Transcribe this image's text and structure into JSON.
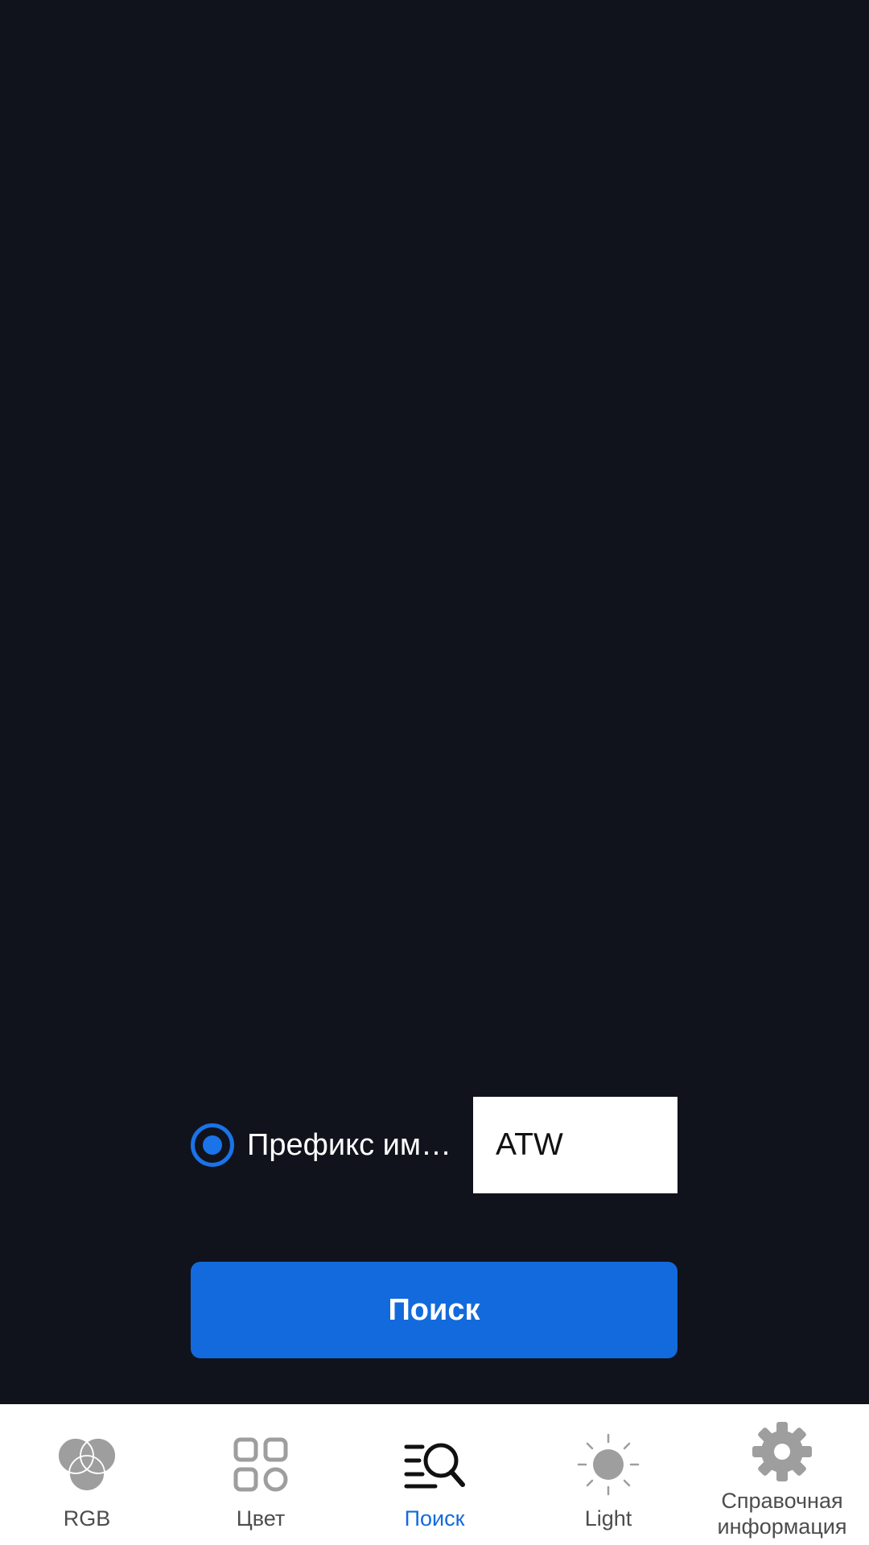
{
  "prefix": {
    "label": "Префикс им…",
    "value": "ATW",
    "selected": true
  },
  "search_button": {
    "label": "Поиск"
  },
  "nav": {
    "active": "Поиск",
    "items": [
      {
        "label": "RGB",
        "icon": "rgb-circles-icon"
      },
      {
        "label": "Цвет",
        "icon": "grid-icon"
      },
      {
        "label": "Поиск",
        "icon": "list-search-icon"
      },
      {
        "label": "Light",
        "icon": "sun-icon"
      },
      {
        "label": "Справочная информация",
        "icon": "gear-icon"
      }
    ]
  },
  "colors": {
    "background": "#10131c",
    "accent": "#136adc",
    "nav_background": "#ffffff",
    "nav_text": "#4d4d4d",
    "icon_gray": "#9e9e9e"
  }
}
